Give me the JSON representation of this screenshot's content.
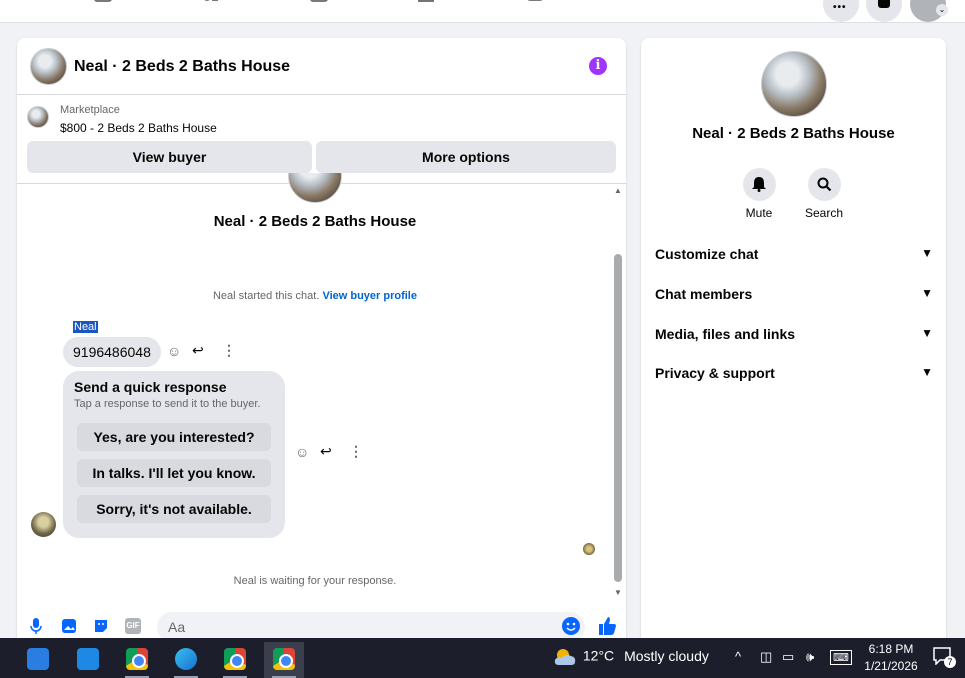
{
  "chat_header": {
    "title": "Neal · 2 Beds 2 Baths House",
    "info_icon": "info-icon"
  },
  "listing": {
    "kicker": "Marketplace",
    "price_title": "$800 - 2 Beds 2 Baths House",
    "view_buyer": "View buyer",
    "more_options": "More options"
  },
  "conversation": {
    "title": "Neal · 2 Beds 2 Baths House",
    "started_text": "Neal started this chat.",
    "view_profile": "View buyer profile",
    "sender_name": "Neal",
    "phone_message": "9196486048",
    "quick_heading": "Send a quick response",
    "quick_sub": "Tap a response to send it to the buyer.",
    "quick_options": [
      "Yes, are you interested?",
      "In talks. I'll let you know.",
      "Sorry, it's not available."
    ],
    "waiting_text": "Neal is waiting for your response."
  },
  "composer": {
    "placeholder": "Aa",
    "gif_label": "GIF"
  },
  "side": {
    "name": "Neal · 2 Beds 2 Baths House",
    "mute_label": "Mute",
    "search_label": "Search",
    "sections": [
      "Customize chat",
      "Chat members",
      "Media, files and links",
      "Privacy & support"
    ]
  },
  "taskbar": {
    "temperature": "12°C",
    "condition": "Mostly cloudy",
    "time": "6:18 PM",
    "date": "1/21/2026",
    "notification_count": "7"
  },
  "colors": {
    "accent": "#0866ff",
    "info": "#a033ff",
    "link": "#0064d1",
    "taskbar": "#1c1f2b"
  }
}
